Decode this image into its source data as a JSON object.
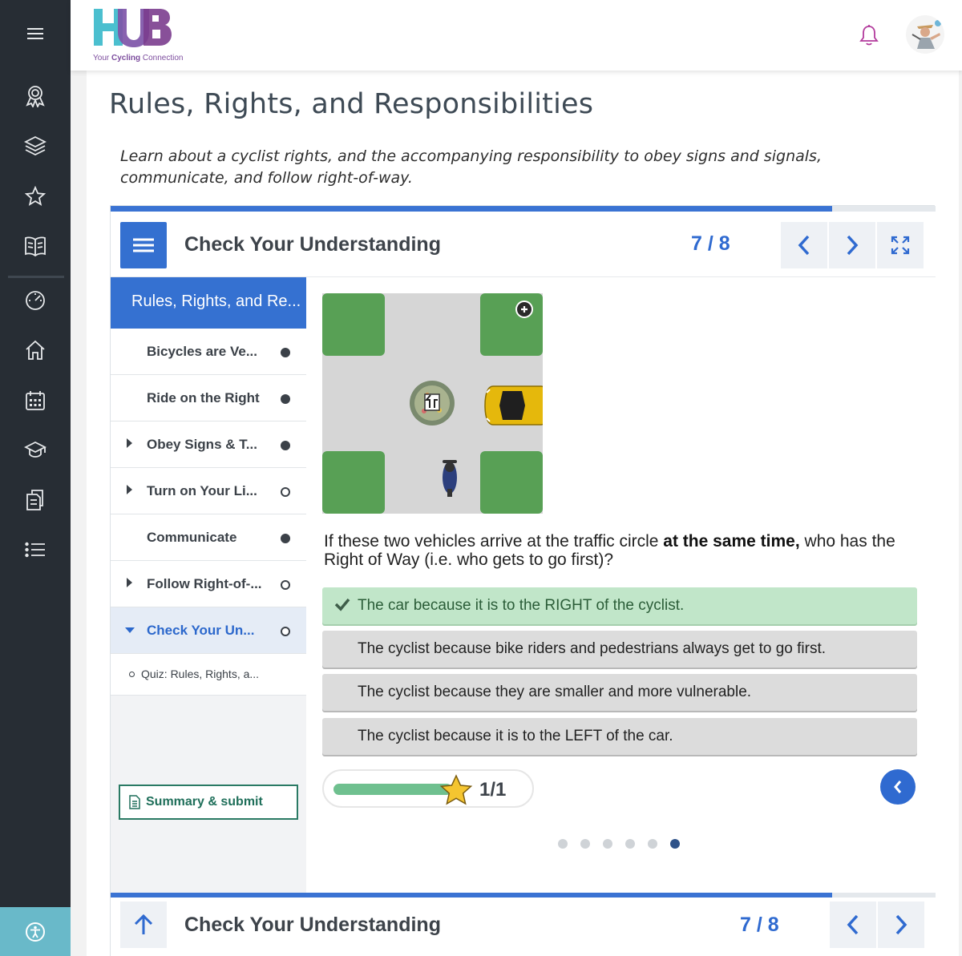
{
  "brand": {
    "logo_text": "HUB",
    "tagline_pre": "Your ",
    "tagline_bold": "Cycling",
    "tagline_post": " Connection"
  },
  "rail": {
    "icons": [
      "menu-icon",
      "badge-icon",
      "layers-icon",
      "star-icon",
      "book-icon",
      "dashboard-icon",
      "home-icon",
      "calendar-icon",
      "graduation-cap-icon",
      "documents-icon",
      "list-icon",
      "accessibility-icon"
    ]
  },
  "page": {
    "title": "Rules, Rights, and Responsibilities",
    "description": "Learn about a cyclist rights, and the accompanying responsibility to obey signs and signals, communicate, and follow right-of-way."
  },
  "player": {
    "header_title": "Check Your Understanding",
    "page_count": "7 / 8",
    "progress_fraction": 0.875,
    "footer_title": "Check Your Understanding",
    "footer_count": "7 / 8"
  },
  "sidenav": {
    "heading": "Rules, Rights, and Re...",
    "items": [
      {
        "label": "Bicycles are Ve...",
        "status": "filled",
        "expandable": false
      },
      {
        "label": "Ride on the Right",
        "status": "filled",
        "expandable": false
      },
      {
        "label": "Obey Signs & T...",
        "status": "filled",
        "expandable": true
      },
      {
        "label": "Turn on Your Li...",
        "status": "empty",
        "expandable": true
      },
      {
        "label": "Communicate",
        "status": "filled",
        "expandable": false
      },
      {
        "label": "Follow Right-of-...",
        "status": "empty",
        "expandable": true
      },
      {
        "label": "Check Your Un...",
        "status": "empty",
        "expandable": true,
        "active": true
      }
    ],
    "sub_item": "Quiz: Rules, Rights, a...",
    "summary_button": "Summary & submit"
  },
  "question": {
    "text_pre": "If these two vehicles arrive at the traffic circle ",
    "text_bold": "at the same time,",
    "text_post": " who has the Right of Way (i.e. who gets to go first)?",
    "answers": [
      {
        "label": "The car because it is to the RIGHT of the cyclist.",
        "correct": true
      },
      {
        "label": "The cyclist because bike riders and pedestrians always get to go first.",
        "correct": false
      },
      {
        "label": "The cyclist because they are smaller and more vulnerable.",
        "correct": false
      },
      {
        "label": "The cyclist because it is to the LEFT of the car.",
        "correct": false
      }
    ],
    "score": "1/1",
    "score_fraction": 1.0,
    "slide_dots": 6,
    "active_dot": 6
  },
  "colors": {
    "rail": "#272d34",
    "accent_blue": "#3571d1",
    "correct_green": "#c1e6c9",
    "access_teal": "#69b9c9",
    "brand_purple": "#7d4d9e"
  }
}
